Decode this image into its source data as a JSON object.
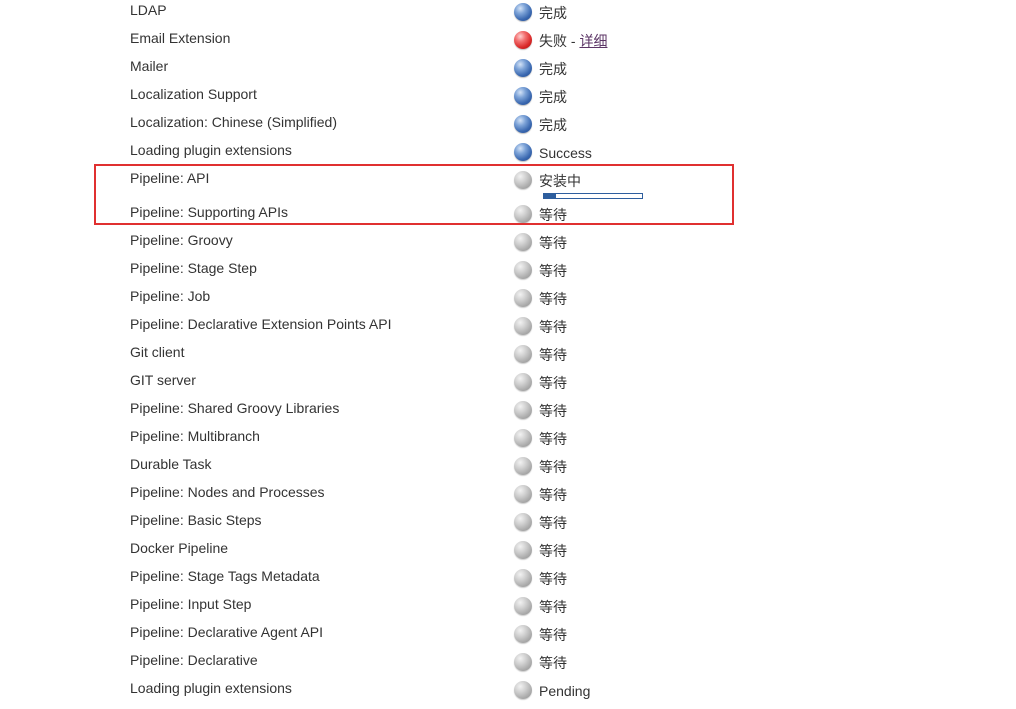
{
  "plugins": [
    {
      "name": "LDAP",
      "status": "完成",
      "state": "done"
    },
    {
      "name": "Email Extension",
      "status": "失败",
      "state": "failed",
      "separator": " - ",
      "detail_link": "详细"
    },
    {
      "name": "Mailer",
      "status": "完成",
      "state": "done"
    },
    {
      "name": "Localization Support",
      "status": "完成",
      "state": "done"
    },
    {
      "name": "Localization: Chinese (Simplified)",
      "status": "完成",
      "state": "done"
    },
    {
      "name": "Loading plugin extensions",
      "status": "Success",
      "state": "done"
    },
    {
      "name": "Pipeline: API",
      "status": "安装中",
      "state": "installing",
      "progress": 0.12
    },
    {
      "name": "Pipeline: Supporting APIs",
      "status": "等待",
      "state": "pending"
    },
    {
      "name": "Pipeline: Groovy",
      "status": "等待",
      "state": "pending"
    },
    {
      "name": "Pipeline: Stage Step",
      "status": "等待",
      "state": "pending"
    },
    {
      "name": "Pipeline: Job",
      "status": "等待",
      "state": "pending"
    },
    {
      "name": "Pipeline: Declarative Extension Points API",
      "status": "等待",
      "state": "pending"
    },
    {
      "name": "Git client",
      "status": "等待",
      "state": "pending"
    },
    {
      "name": "GIT server",
      "status": "等待",
      "state": "pending"
    },
    {
      "name": "Pipeline: Shared Groovy Libraries",
      "status": "等待",
      "state": "pending"
    },
    {
      "name": "Pipeline: Multibranch",
      "status": "等待",
      "state": "pending"
    },
    {
      "name": "Durable Task",
      "status": "等待",
      "state": "pending"
    },
    {
      "name": "Pipeline: Nodes and Processes",
      "status": "等待",
      "state": "pending"
    },
    {
      "name": "Pipeline: Basic Steps",
      "status": "等待",
      "state": "pending"
    },
    {
      "name": "Docker Pipeline",
      "status": "等待",
      "state": "pending"
    },
    {
      "name": "Pipeline: Stage Tags Metadata",
      "status": "等待",
      "state": "pending"
    },
    {
      "name": "Pipeline: Input Step",
      "status": "等待",
      "state": "pending"
    },
    {
      "name": "Pipeline: Declarative Agent API",
      "status": "等待",
      "state": "pending"
    },
    {
      "name": "Pipeline: Declarative",
      "status": "等待",
      "state": "pending"
    },
    {
      "name": "Loading plugin extensions",
      "status": "Pending",
      "state": "pending"
    }
  ],
  "state_icons": {
    "done": "blue-ball-icon",
    "failed": "red-ball-icon",
    "installing": "grey-ball-icon",
    "pending": "grey-ball-icon"
  },
  "colors": {
    "done": "#3a68b0",
    "failed": "#d92828",
    "pending": "#a9a9a9",
    "progress": "#2e5e9e",
    "highlight": "#e03030"
  }
}
